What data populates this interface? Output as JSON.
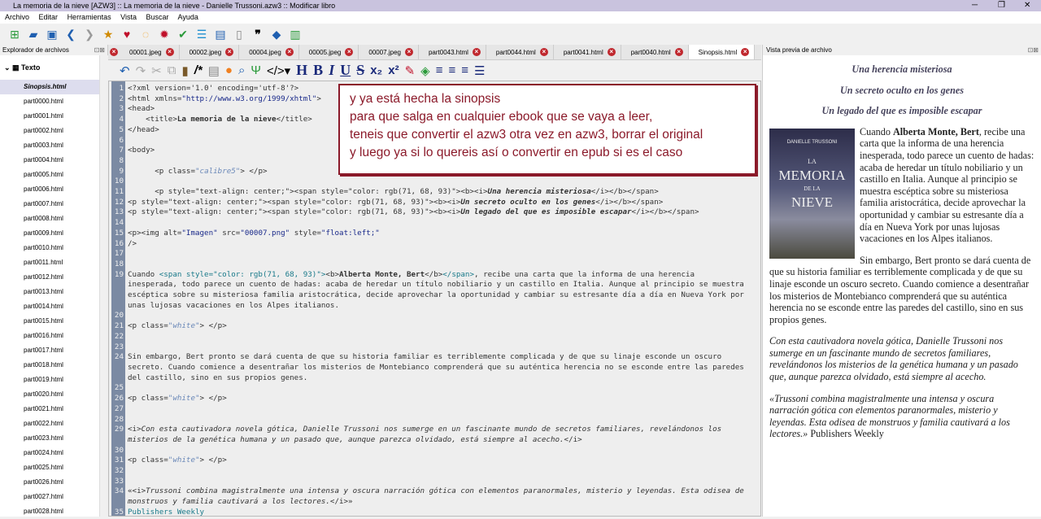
{
  "window": {
    "title": "La memoria de la nieve [AZW3] :: La memoria de la nieve - Danielle Trussoni.azw3 :: Modificar libro"
  },
  "menu": [
    "Archivo",
    "Editar",
    "Herramientas",
    "Vista",
    "Buscar",
    "Ayuda"
  ],
  "file_browser": {
    "title": "Explorador de archivos",
    "root": "Texto",
    "files": [
      "Sinopsis.html",
      "part0000.html",
      "part0001.html",
      "part0002.html",
      "part0003.html",
      "part0004.html",
      "part0005.html",
      "part0006.html",
      "part0007.html",
      "part0008.html",
      "part0009.html",
      "part0010.html",
      "part0011.html",
      "part0012.html",
      "part0013.html",
      "part0014.html",
      "part0015.html",
      "part0016.html",
      "part0017.html",
      "part0018.html",
      "part0019.html",
      "part0020.html",
      "part0021.html",
      "part0022.html",
      "part0023.html",
      "part0024.html",
      "part0025.html",
      "part0026.html",
      "part0027.html",
      "part0028.html"
    ]
  },
  "tabs": [
    "00001.jpeg",
    "00002.jpeg",
    "00004.jpeg",
    "00005.jpeg",
    "00007.jpeg",
    "part0043.html",
    "part0044.html",
    "part0041.html",
    "part0040.html",
    "Sinopsis.html"
  ],
  "active_tab": "Sinopsis.html",
  "code_lines": [
    [
      [
        "tag",
        "<?xml version='1.0' encoding='utf-8'?>"
      ]
    ],
    [
      [
        "tag",
        "<html xmlns="
      ],
      [
        "str",
        "\"http://www.w3.org/1999/xhtml\""
      ],
      [
        "tag",
        ">"
      ]
    ],
    [
      [
        "tag",
        "<head>"
      ]
    ],
    [
      [
        "tag",
        "    <title>"
      ],
      [
        "b",
        "La memoria de la nieve"
      ],
      [
        "tag",
        "</title>"
      ]
    ],
    [
      [
        "tag",
        "</head>"
      ]
    ],
    [],
    [
      [
        "tag",
        "<body>"
      ]
    ],
    [],
    [
      [
        "tag",
        "      <p class="
      ],
      [
        "cls",
        "\"calibre5\""
      ],
      [
        "tag",
        "> </p>"
      ]
    ],
    [],
    [
      [
        "tag",
        "      <p style=\"text-align: center;\"><span style=\"color: rgb(71, 68, 93)\"><b><i>"
      ],
      [
        "bi",
        "Una herencia misteriosa"
      ],
      [
        "tag",
        "</i></b></span>"
      ]
    ],
    [
      [
        "tag",
        "<p style=\"text-align: center;\"><span style=\"color: rgb(71, 68, 93)\"><b><i>"
      ],
      [
        "bi",
        "Un secreto oculto en los genes"
      ],
      [
        "tag",
        "</i></b></span>"
      ]
    ],
    [
      [
        "tag",
        "<p style=\"text-align: center;\"><span style=\"color: rgb(71, 68, 93)\"><b><i>"
      ],
      [
        "bi",
        "Un legado del que es imposible escapar"
      ],
      [
        "tag",
        "</i></b></span>"
      ]
    ],
    [],
    [
      [
        "tag",
        "<p><img alt="
      ],
      [
        "str",
        "\"Imagen\""
      ],
      [
        "tag",
        " src="
      ],
      [
        "str",
        "\"00007.png\""
      ],
      [
        "tag",
        " style="
      ],
      [
        "str",
        "\"float:left;\""
      ]
    ],
    [
      [
        "tag",
        "/>"
      ]
    ],
    [],
    [],
    [
      [
        "tag",
        "Cuando "
      ],
      [
        "teal",
        "<span style=\"color: rgb(71, 68, 93)\">"
      ],
      [
        "tag",
        "<b>"
      ],
      [
        "b",
        "Alberta Monte, Bert"
      ],
      [
        "tag",
        "</b>"
      ],
      [
        "teal",
        "</span>"
      ],
      [
        "tag",
        ", recibe una carta que la informa de una herencia inesperada, todo parece un cuento de hadas: acaba de heredar un título nobiliario y un castillo en Italia. Aunque al principio se muestra escéptica sobre su misteriosa familia aristocrática, decide aprovechar la oportunidad y cambiar su estresante día a día en Nueva York por unas lujosas vacaciones en los Alpes italianos."
      ]
    ],
    [],
    [
      [
        "tag",
        "<p class="
      ],
      [
        "cls",
        "\"white\""
      ],
      [
        "tag",
        "> </p>"
      ]
    ],
    [],
    [],
    [
      [
        "tag",
        "Sin embargo, Bert pronto se dará cuenta de que su historia familiar es terriblemente complicada y de que su linaje esconde un oscuro secreto. Cuando comience a desentrañar los misterios de Montebianco comprenderá que su auténtica herencia no se esconde entre las paredes del castillo, sino en sus propios genes."
      ]
    ],
    [],
    [
      [
        "tag",
        "<p class="
      ],
      [
        "cls",
        "\"white\""
      ],
      [
        "tag",
        "> </p>"
      ]
    ],
    [],
    [],
    [
      [
        "tag",
        "<i>"
      ],
      [
        "it",
        "Con esta cautivadora novela gótica, Danielle Trussoni nos sumerge en un fascinante mundo de secretos familiares, revelándonos los misterios de la genética humana y un pasado que, aunque parezca olvidado, está siempre al acecho."
      ],
      [
        "tag",
        "</i>"
      ]
    ],
    [],
    [
      [
        "tag",
        "<p class="
      ],
      [
        "cls",
        "\"white\""
      ],
      [
        "tag",
        "> </p>"
      ]
    ],
    [],
    [],
    [
      [
        "tag",
        "«<i>"
      ],
      [
        "it",
        "Trussoni combina magistralmente una intensa y oscura narración gótica con elementos paranormales, misterio y leyendas. Esta odisea de monstruos y familia cautivará a los lectores."
      ],
      [
        "tag",
        "</i>»"
      ]
    ],
    [
      [
        "teal",
        "Publishers Weekly"
      ]
    ]
  ],
  "annotation": [
    "y ya está hecha la sinopsis",
    "para que salga en cualquier ebook que se vaya a leer,",
    "teneis que convertir el azw3 otra vez en azw3, borrar el original",
    "y luego ya si lo quereis así o convertir en epub si es el caso"
  ],
  "preview": {
    "title": "Vista previa de archivo",
    "headings": [
      "Una herencia misteriosa",
      "Un secreto oculto en los genes",
      "Un legado del que es imposible escapar"
    ],
    "cover": {
      "author": "DANIELLE TRUSSONI",
      "l1": "LA",
      "l2": "MEMORIA",
      "l3": "DE LA",
      "l4": "NIEVE"
    },
    "p1_start": "Cuando ",
    "p1_bold": "Alberta Monte, Bert",
    "p1_rest": ", recibe una carta que la informa de una herencia inesperada, todo parece un cuento de hadas: acaba de heredar un título nobiliario y un castillo en Italia. Aunque al principio se muestra escéptica sobre su misteriosa familia aristocrática, decide aprovechar la oportunidad y cambiar su estresante día a día en Nueva York por unas lujosas vacaciones en los Alpes italianos.",
    "p2": "Sin embargo, Bert pronto se dará cuenta de que su historia familiar es terriblemente complicada y de que su linaje esconde un oscuro secreto. Cuando comience a desentrañar los misterios de Montebianco comprenderá que su auténtica herencia no se esconde entre las paredes del castillo, sino en sus propios genes.",
    "p3": "Con esta cautivadora novela gótica, Danielle Trussoni nos sumerge en un fascinante mundo de secretos familiares, revelándonos los misterios de la genética humana y un pasado que, aunque parezca olvidado, está siempre al acecho.",
    "p4_it": "«Trussoni combina magistralmente una intensa y oscura narración gótica con elementos paranormales, misterio y leyendas. Esta odisea de monstruos y familia cautivará a los lectores.»",
    "p4_rest": " Publishers Weekly"
  }
}
